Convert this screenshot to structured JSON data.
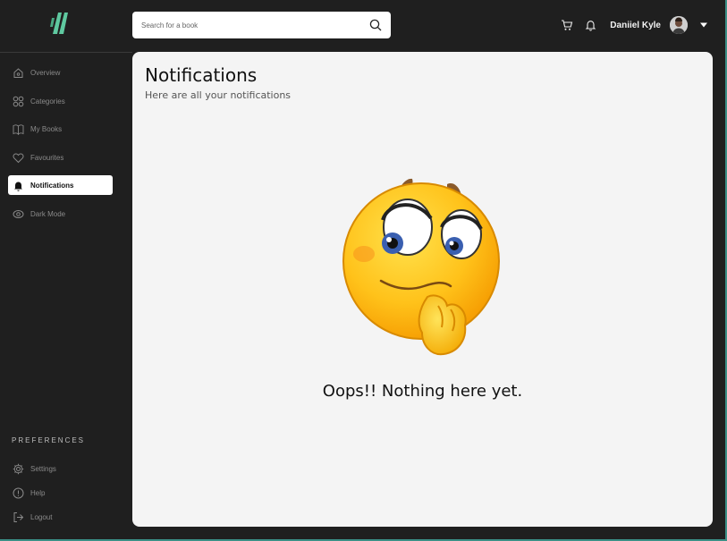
{
  "header": {
    "search_placeholder": "Search for a book",
    "user_name": "Daniiel Kyle",
    "icons": [
      "cart-icon",
      "bell-icon",
      "chevron-down-icon",
      "search-icon"
    ]
  },
  "sidebar": {
    "items": [
      {
        "label": "Overview",
        "icon": "home-icon"
      },
      {
        "label": "Categories",
        "icon": "grid-icon"
      },
      {
        "label": "My Books",
        "icon": "book-icon"
      },
      {
        "label": "Favourites",
        "icon": "heart-icon"
      },
      {
        "label": "Notifications",
        "icon": "bell-icon",
        "active": true
      },
      {
        "label": "Dark Mode",
        "icon": "eye-icon"
      }
    ],
    "preferences_title": "PREFERENCES",
    "preferences": [
      {
        "label": "Settings",
        "icon": "gear-icon"
      },
      {
        "label": "Help",
        "icon": "info-icon"
      },
      {
        "label": "Logout",
        "icon": "logout-icon"
      }
    ]
  },
  "main": {
    "title": "Notifications",
    "subtitle": "Here are all your notifications",
    "empty_message": "Oops!!  Nothing here yet."
  },
  "colors": {
    "background": "#1f1f1f",
    "panel": "#f4f4f4",
    "accent": "#5fc9a0",
    "frame": "#3a8f86"
  }
}
